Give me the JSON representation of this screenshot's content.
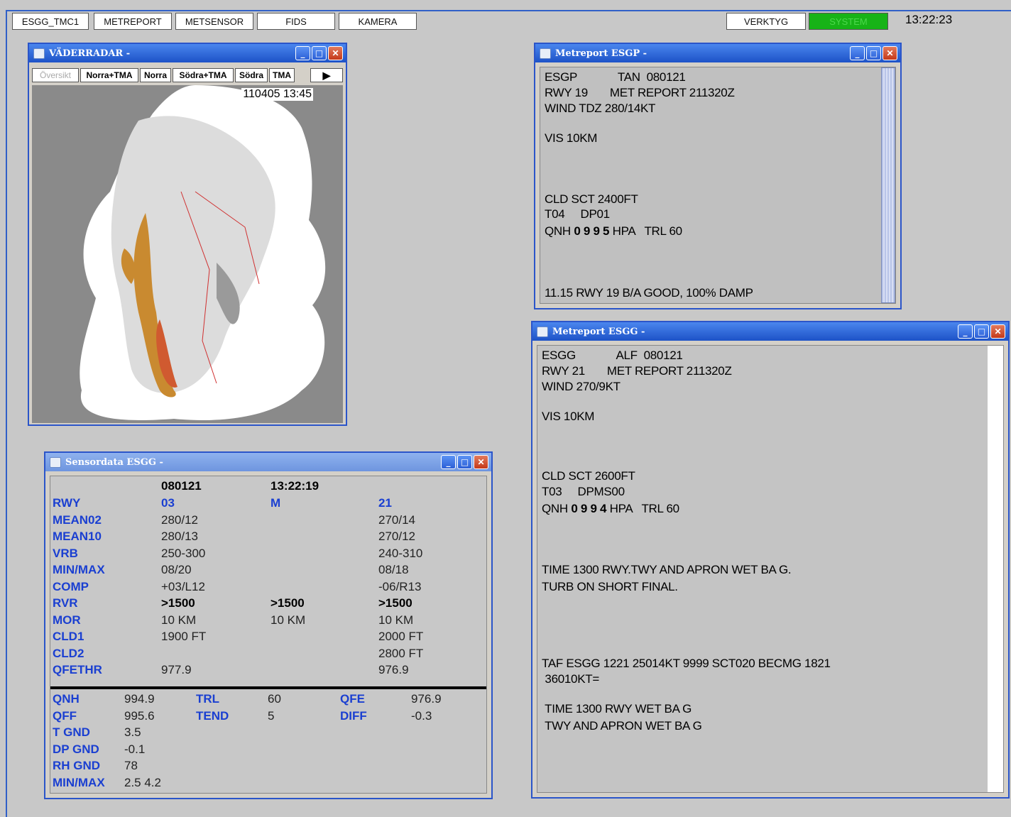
{
  "top_nav": {
    "buttons": [
      "ESGG_TMC1",
      "METREPORT",
      "METSENSOR",
      "FIDS",
      "KAMERA"
    ],
    "verktyg": "VERKTYG",
    "system": "SYSTEM",
    "clock": "13:22:23",
    "system_color": "#17b317"
  },
  "radar": {
    "title": "VÄDERRADAR -",
    "tabs": [
      "Översikt",
      "Norra+TMA",
      "Norra",
      "Södra+TMA",
      "Södra",
      "TMA"
    ],
    "play": "▶",
    "timestamp": "110405 13:45"
  },
  "met_esgp": {
    "title": "Metreport ESGP -",
    "lines": [
      "ESGP             TAN  080121",
      "RWY 19       MET REPORT 211320Z",
      "WIND TDZ 280/14KT",
      "",
      "VIS 10KM",
      "",
      "",
      "",
      "CLD SCT 2400FT",
      "T04     DP01"
    ],
    "qnh_prefix": "QNH ",
    "qnh_value": "0 9 9 5",
    "qnh_suffix": " HPA   TRL 60",
    "footer": "11.15 RWY 19 B/A GOOD, 100% DAMP"
  },
  "met_esgg": {
    "title": "Metreport ESGG -",
    "lines": [
      "ESGG             ALF  080121",
      "RWY 21       MET REPORT 211320Z",
      "WIND 270/9KT",
      "",
      "VIS 10KM",
      "",
      "",
      "",
      "CLD SCT 2600FT",
      "T03     DPMS00"
    ],
    "qnh_prefix": "QNH ",
    "qnh_value": "0 9 9 4",
    "qnh_suffix": " HPA   TRL 60",
    "remarks": [
      "TIME 1300 RWY.TWY AND APRON WET BA G.",
      "TURB ON SHORT FINAL."
    ],
    "taf": [
      "TAF ESGG 1221 25014KT 9999 SCT020 BECMG 1821",
      " 36010KT="
    ],
    "taf_remarks": [
      " TIME 1300 RWY WET BA G",
      " TWY AND APRON WET BA G"
    ]
  },
  "sensor": {
    "title": "Sensordata ESGG -",
    "date": "080121",
    "time": "13:22:19",
    "rows": [
      {
        "label": "RWY",
        "c1": "03",
        "c2": "M",
        "c3": "21"
      },
      {
        "label": "MEAN02",
        "c1": "280/12",
        "c2": "",
        "c3": "270/14"
      },
      {
        "label": "MEAN10",
        "c1": "280/13",
        "c2": "",
        "c3": "270/12"
      },
      {
        "label": "VRB",
        "c1": "250-300",
        "c2": "",
        "c3": "240-310"
      },
      {
        "label": "MIN/MAX",
        "c1": "08/20",
        "c2": "",
        "c3": "08/18"
      },
      {
        "label": "COMP",
        "c1": "+03/L12",
        "c2": "",
        "c3": "-06/R13"
      },
      {
        "label": "RVR",
        "c1": ">1500",
        "c2": ">1500",
        "c3": ">1500"
      },
      {
        "label": "MOR",
        "c1": "10 KM",
        "c2": "10 KM",
        "c3": "10 KM"
      },
      {
        "label": "CLD1",
        "c1": "1900 FT",
        "c2": "",
        "c3": "2000 FT"
      },
      {
        "label": "CLD2",
        "c1": "",
        "c2": "",
        "c3": "2800 FT"
      },
      {
        "label": "QFETHR",
        "c1": "977.9",
        "c2": "",
        "c3": "976.9"
      }
    ],
    "lower": [
      {
        "l1": "QNH",
        "v1": "994.9",
        "l2": "TRL",
        "v2": "60",
        "l3": "QFE",
        "v3": "976.9"
      },
      {
        "l1": "QFF",
        "v1": "995.6",
        "l2": "TEND",
        "v2": "5",
        "l3": "DIFF",
        "v3": "-0.3"
      },
      {
        "l1": "T GND",
        "v1": "3.5",
        "l2": "",
        "v2": "",
        "l3": "",
        "v3": ""
      },
      {
        "l1": "DP GND",
        "v1": "-0.1",
        "l2": "",
        "v2": "",
        "l3": "",
        "v3": ""
      },
      {
        "l1": "RH GND",
        "v1": "78",
        "l2": "",
        "v2": "",
        "l3": "",
        "v3": ""
      },
      {
        "l1": "MIN/MAX",
        "v1": "2.5 4.2",
        "l2": "",
        "v2": "",
        "l3": "",
        "v3": ""
      }
    ]
  }
}
